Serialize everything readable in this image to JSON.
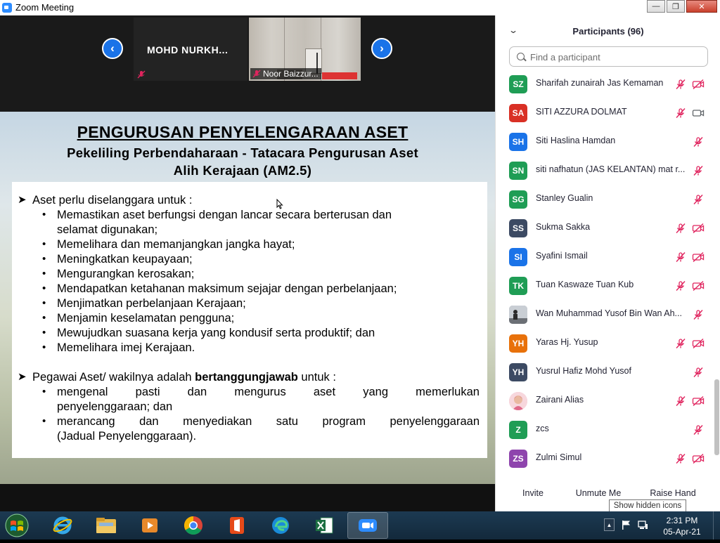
{
  "window": {
    "title": "Zoom Meeting"
  },
  "video_strip": {
    "tile_1_name": "MOHD  NURKH...",
    "tile_2_name": "Noor Baizzur..."
  },
  "slide": {
    "title": "PENGURUSAN PENYELENGARAAN ASET",
    "subtitle_line1": "Pekeliling Perbendaharaan - Tatacara Pengurusan Aset",
    "subtitle_line2": "Alih Kerajaan (AM2.5)",
    "section1_heading": "Aset perlu diselanggara untuk :",
    "section1_bullets": [
      "Memastikan aset berfungsi dengan lancar secara berterusan dan",
      "selamat digunakan;",
      "Memelihara dan memanjangkan jangka hayat;",
      "Meningkatkan keupayaan;",
      "Mengurangkan kerosakan;",
      "Mendapatkan ketahanan maksimum sejajar dengan perbelanjaan;",
      "Menjimatkan perbelanjaan Kerajaan;",
      "Menjamin keselamatan pengguna;",
      "Mewujudkan suasana kerja yang kondusif serta produktif; dan",
      "Memelihara imej Kerajaan."
    ],
    "section2_heading_pre": "Pegawai Aset/ wakilnya adalah ",
    "section2_heading_bold": "bertanggungjawab",
    "section2_heading_post": " untuk :",
    "section2_b1_words": [
      "mengenal",
      "pasti",
      "dan",
      "mengurus",
      "aset",
      "yang",
      "memerlukan"
    ],
    "section2_b1_line2": "penyelenggaraan; dan",
    "section2_b2_words": [
      "merancang",
      "dan",
      "menyediakan",
      "satu",
      "program",
      "penyelenggaraan"
    ],
    "section2_b2_line2": "(Jadual Penyelenggaraan)."
  },
  "participants": {
    "title": "Participants (96)",
    "search_placeholder": "Find a participant",
    "list": [
      {
        "initials": "SZ",
        "name": "Sharifah zunairah Jas Kemaman",
        "color": "#1f9d55",
        "mic": "muted",
        "video": "off"
      },
      {
        "initials": "SA",
        "name": "SITI AZZURA DOLMAT",
        "color": "#d93025",
        "mic": "muted",
        "video": "on"
      },
      {
        "initials": "SH",
        "name": "Siti Haslina Hamdan",
        "color": "#1a73e8",
        "mic": "muted",
        "video": "none"
      },
      {
        "initials": "SN",
        "name": "siti nafhatun (JAS KELANTAN) mat r...",
        "color": "#1f9d55",
        "mic": "muted",
        "video": "none"
      },
      {
        "initials": "SG",
        "name": "Stanley Gualin",
        "color": "#1f9d55",
        "mic": "muted",
        "video": "none"
      },
      {
        "initials": "SS",
        "name": "Sukma Sakka",
        "color": "#3c4a63",
        "mic": "muted",
        "video": "off"
      },
      {
        "initials": "SI",
        "name": "Syafini Ismail",
        "color": "#1a73e8",
        "mic": "muted",
        "video": "off"
      },
      {
        "initials": "TK",
        "name": "Tuan Kaswaze Tuan Kub",
        "color": "#1f9d55",
        "mic": "muted",
        "video": "off"
      },
      {
        "initials": "",
        "name": "Wan Muhammad Yusof Bin Wan Ah...",
        "color": "#8a8f96",
        "mic": "muted",
        "video": "none",
        "photo": "silhouette"
      },
      {
        "initials": "YH",
        "name": "Yaras Hj. Yusup",
        "color": "#e8710a",
        "mic": "muted",
        "video": "off"
      },
      {
        "initials": "YH",
        "name": "Yusrul Hafiz Mohd Yusof",
        "color": "#3c4a63",
        "mic": "muted",
        "video": "none"
      },
      {
        "initials": "",
        "name": "Zairani Alias",
        "color": "#f2b8c6",
        "mic": "muted",
        "video": "off",
        "photo": "portrait"
      },
      {
        "initials": "Z",
        "name": "zcs",
        "color": "#1f9d55",
        "mic": "muted",
        "video": "none"
      },
      {
        "initials": "ZS",
        "name": "Zulmi Simul",
        "color": "#8e44ad",
        "mic": "muted",
        "video": "off"
      }
    ],
    "buttons": {
      "invite": "Invite",
      "unmute": "Unmute Me",
      "raise_hand": "Raise Hand"
    },
    "tooltip": "Show hidden icons"
  },
  "taskbar": {
    "apps": [
      "windows-start",
      "internet-explorer",
      "file-explorer",
      "media-player",
      "chrome",
      "office",
      "edge",
      "excel",
      "zoom"
    ],
    "active_app": "zoom",
    "time": "2:31 PM",
    "date": "05-Apr-21"
  },
  "colors": {
    "accent": "#1a73e8",
    "mute_red": "#e0245e",
    "zoom_blue": "#2d8cff"
  }
}
